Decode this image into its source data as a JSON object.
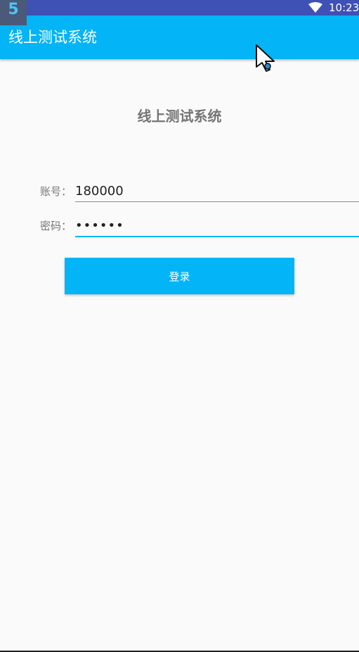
{
  "status_bar": {
    "app_icon": "5",
    "time": "10:23",
    "icons": [
      "app-notification-icon",
      "wifi-icon"
    ]
  },
  "app_bar": {
    "title": "线上测试系统"
  },
  "login": {
    "heading": "线上测试系统",
    "account_label": "账号：",
    "account_value": "180000",
    "password_label": "密码：",
    "password_value": "••••••",
    "submit_label": "登录"
  },
  "colors": {
    "status_bar": "#3f51b5",
    "primary": "#03b4f6",
    "background": "#fafafa",
    "label_text": "#757575"
  }
}
